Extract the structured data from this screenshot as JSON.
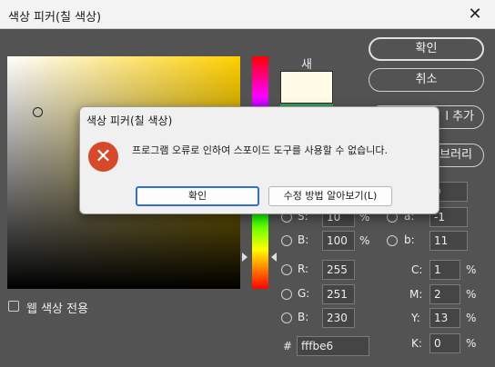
{
  "window": {
    "title": "색상 피커(칠 색상)",
    "close_glyph": "✕"
  },
  "swatch": {
    "new_label": "새",
    "new_color": "#fffbe6"
  },
  "buttons": {
    "ok": "확인",
    "cancel": "취소",
    "add_partial": "l 추가",
    "library_partial": "브러리"
  },
  "hsb": {
    "h_value_partial": "9",
    "s_label": "S:",
    "s_value": "10",
    "s_unit": "%",
    "b_label": "B:",
    "b_value": "100",
    "b_unit": "%"
  },
  "lab": {
    "a_label": "a:",
    "a_value": "-1",
    "b_label": "b:",
    "b_value": "11"
  },
  "rgb": {
    "r_label": "R:",
    "r_value": "255",
    "g_label": "G:",
    "g_value": "251",
    "b_label": "B:",
    "b_value": "230"
  },
  "cmyk": {
    "c_label": "C:",
    "c_value": "1",
    "c_unit": "%",
    "m_label": "M:",
    "m_value": "2",
    "m_unit": "%",
    "y_label": "Y:",
    "y_value": "13",
    "y_unit": "%",
    "k_label": "K:",
    "k_value": "0",
    "k_unit": "%"
  },
  "hex": {
    "label": "#",
    "value": "fffbe6"
  },
  "websafe": {
    "label": "웹 색상 전용"
  },
  "dialog": {
    "title": "색상 피커(칠 색상)",
    "icon": "error-icon",
    "icon_glyph": "✕",
    "message": "프로그램 오류로 인하여 스포이드 도구를 사용할 수 없습니다.",
    "ok_label": "확인",
    "fix_label": "수정 방법 알아보기(L)"
  },
  "colors": {
    "window_bg": "#535353",
    "error_red": "#d6492a",
    "default_button_border": "#2f6fd6"
  }
}
